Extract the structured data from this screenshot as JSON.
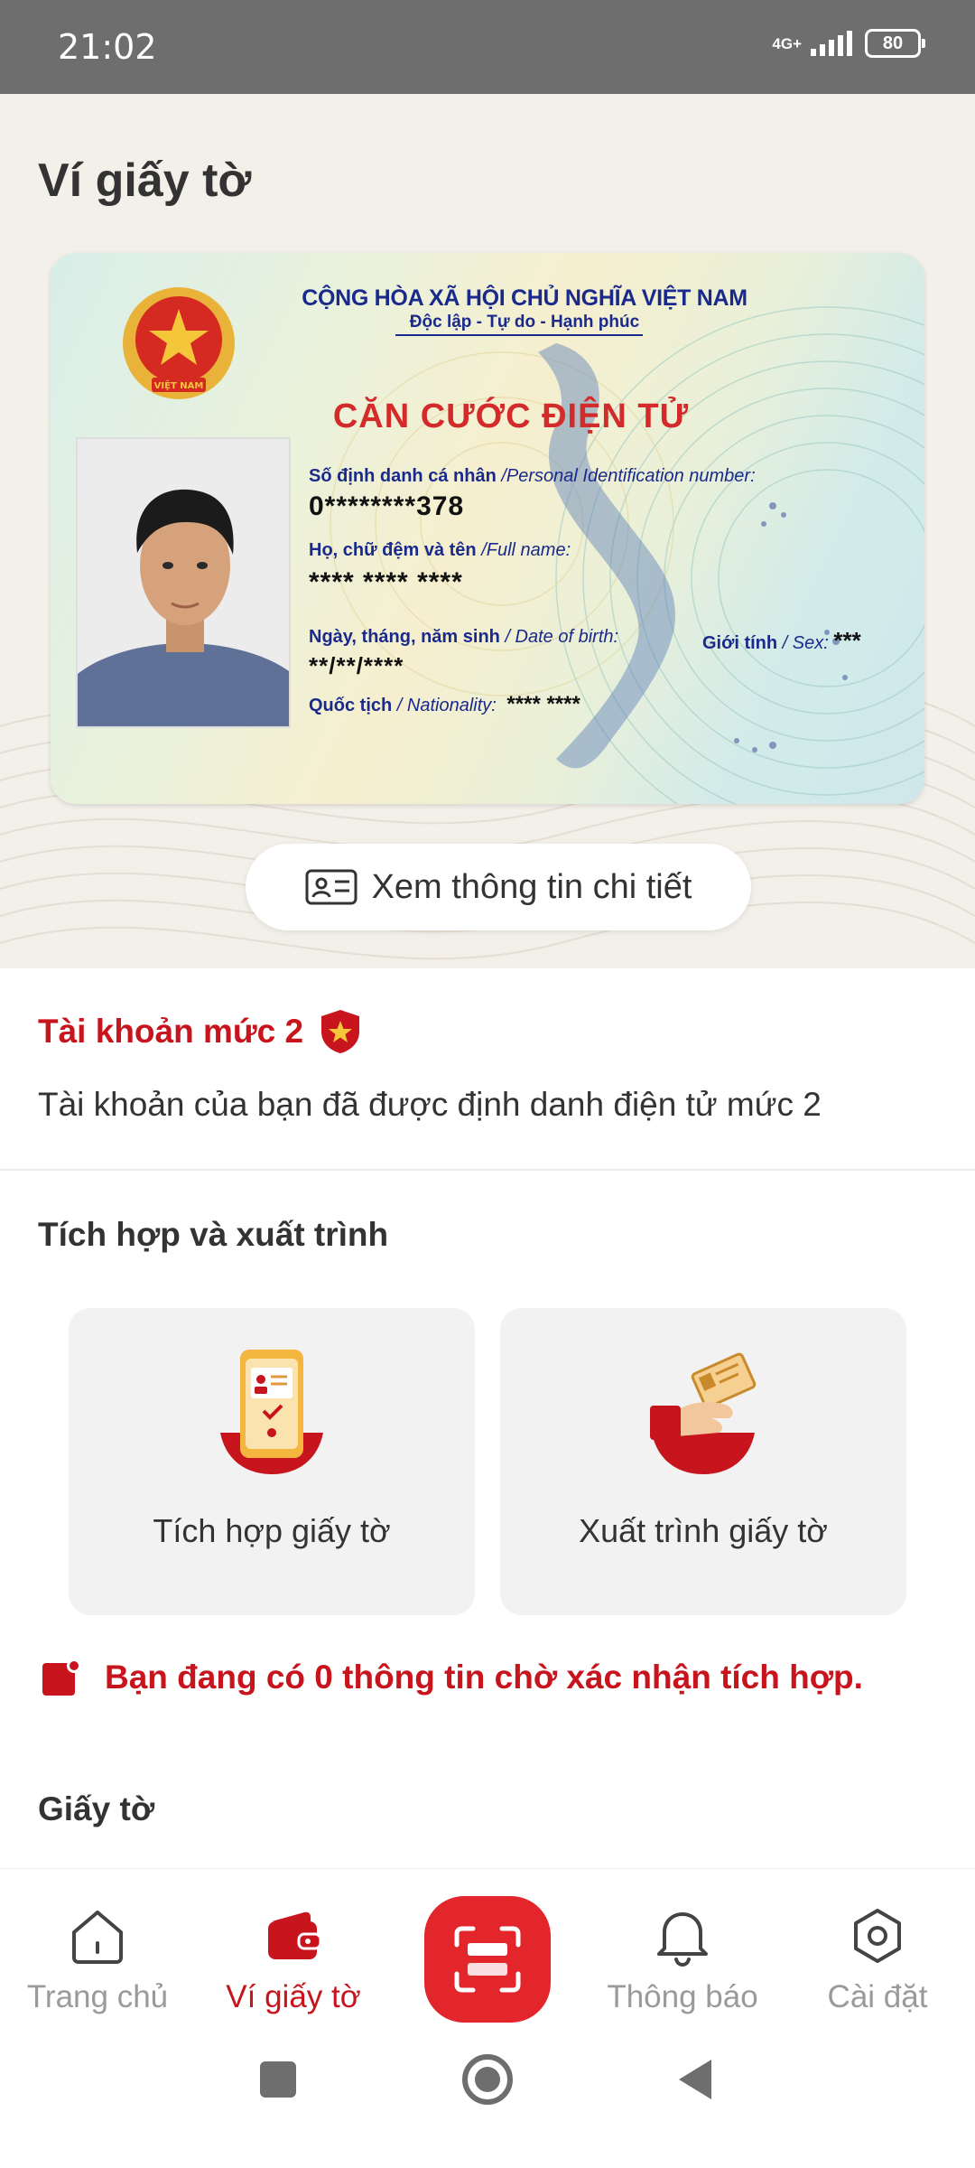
{
  "status_bar": {
    "time": "21:02",
    "network": "4G+",
    "battery": "80"
  },
  "header": {
    "title": "Ví giấy tờ"
  },
  "id_card": {
    "country": "CỘNG HÒA XÃ HỘI CHỦ NGHĨA VIỆT NAM",
    "motto": "Độc lập - Tự do - Hạnh phúc",
    "emblem_text": "VIỆT NAM",
    "card_title": "CĂN CƯỚC ĐIỆN TỬ",
    "id_label": "Số định danh cá nhân",
    "id_label_en": "/Personal Identification number:",
    "id_value": "0********378",
    "name_label": "Họ, chữ đệm và tên",
    "name_label_en": "/Full name:",
    "name_value": "**** **** ****",
    "dob_label": "Ngày, tháng, năm sinh",
    "dob_label_en": "/ Date of birth:",
    "dob_value": "**/**/****",
    "sex_label": "Giới tính",
    "sex_label_en": "/ Sex:",
    "sex_value": "***",
    "nationality_label": "Quốc tịch",
    "nationality_label_en": "/ Nationality:",
    "nationality_value": "**** ****"
  },
  "view_details": {
    "label": "Xem thông tin chi tiết"
  },
  "account": {
    "title": "Tài khoản mức 2",
    "description": "Tài khoản của bạn đã được định danh điện tử mức 2"
  },
  "integration": {
    "title": "Tích hợp và xuất trình",
    "tiles": [
      {
        "label": "Tích hợp giấy tờ",
        "icon": "phone-document-icon"
      },
      {
        "label": "Xuất trình giấy tờ",
        "icon": "hand-card-icon"
      }
    ],
    "pending_text": "Bạn đang có 0 thông tin chờ xác nhận tích hợp."
  },
  "documents": {
    "title": "Giấy tờ"
  },
  "bottom_nav": {
    "items": [
      {
        "label": "Trang chủ",
        "icon": "home-icon",
        "active": false
      },
      {
        "label": "Ví giấy tờ",
        "icon": "wallet-icon",
        "active": true
      },
      {
        "label": "",
        "icon": "scan-icon",
        "active": false
      },
      {
        "label": "Thông báo",
        "icon": "bell-icon",
        "active": false
      },
      {
        "label": "Cài đặt",
        "icon": "settings-icon",
        "active": false
      }
    ]
  },
  "colors": {
    "brand_red": "#c8141d",
    "scan_red": "#e3262b",
    "card_blue": "#1a2a8c"
  }
}
